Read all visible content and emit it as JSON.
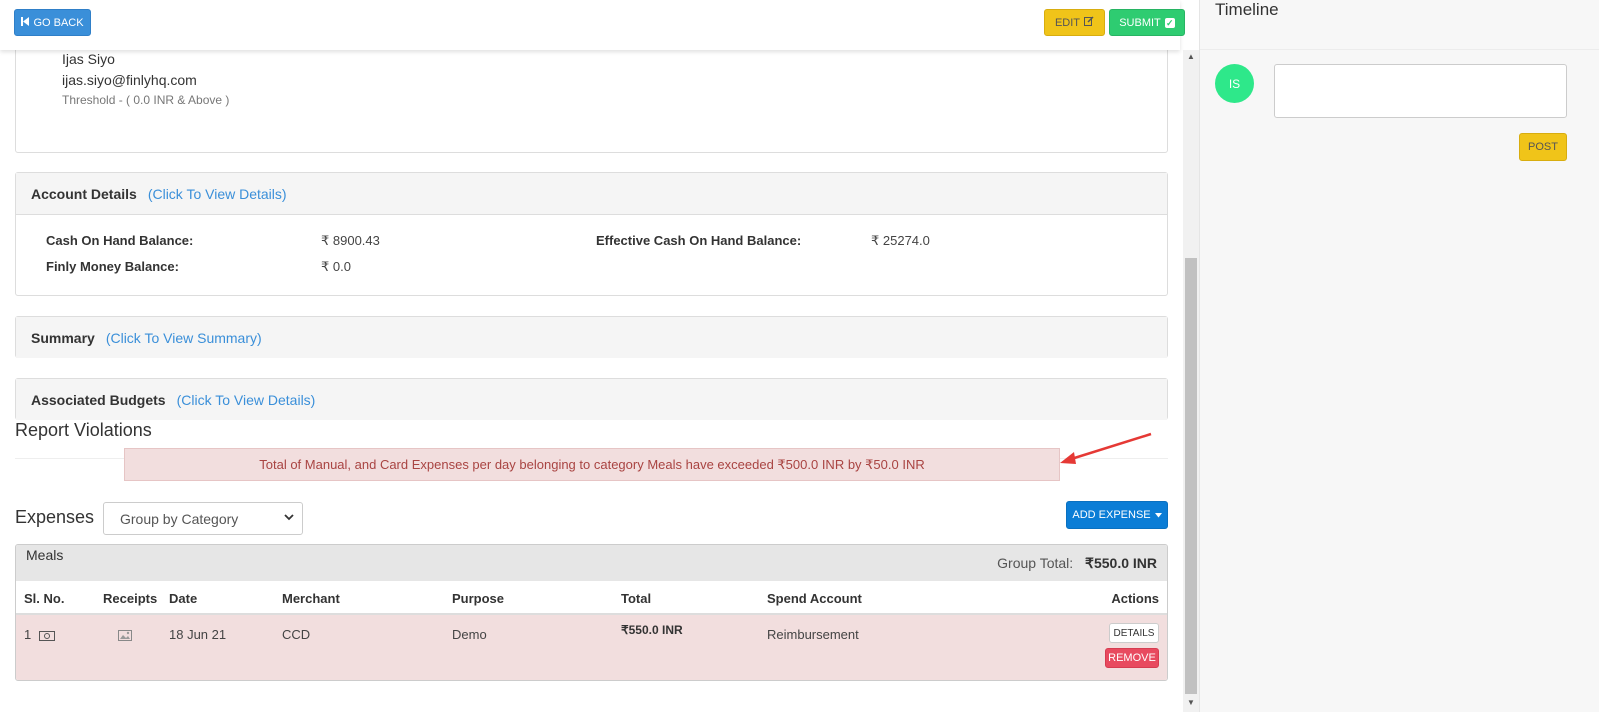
{
  "toolbar": {
    "back_label": "GO BACK",
    "edit_label": "EDIT",
    "submit_label": "SUBMIT"
  },
  "approver": {
    "name": "Ijas Siyo",
    "email": "ijas.siyo@finlyhq.com",
    "threshold": "Threshold -  ( 0.0 INR & Above )"
  },
  "account_details": {
    "title": "Account Details",
    "link": "(Click To View Details)",
    "cash_on_hand_label": "Cash On Hand Balance:",
    "cash_on_hand_value": "₹  8900.43",
    "finly_money_label": "Finly Money Balance:",
    "finly_money_value": "₹  0.0",
    "effective_label": "Effective Cash On Hand Balance:",
    "effective_value": "₹  25274.0"
  },
  "summary": {
    "title": "Summary",
    "link": "(Click To View Summary)"
  },
  "budgets": {
    "title": "Associated Budgets",
    "link": "(Click To View Details)"
  },
  "violations": {
    "title": "Report Violations",
    "message": "Total of Manual, and Card Expenses per day belonging to category Meals have exceeded ₹500.0 INR by ₹50.0 INR"
  },
  "expenses": {
    "title": "Expenses",
    "group_by_selected": "Group by Category",
    "add_label": "ADD EXPENSE",
    "group": {
      "name": "Meals",
      "total_label": "Group Total:",
      "total_value": "₹550.0 INR"
    },
    "columns": [
      "Sl. No.",
      "Receipts",
      "Date",
      "Merchant",
      "Purpose",
      "Total",
      "Spend Account",
      "Actions"
    ],
    "rows": [
      {
        "sl_no": "1",
        "date": "18 Jun 21",
        "merchant": "CCD",
        "purpose": "Demo",
        "total": "₹550.0 INR",
        "spend_account": "Reimbursement",
        "details_label": "DETAILS",
        "remove_label": "REMOVE"
      }
    ]
  },
  "timeline": {
    "title": "Timeline",
    "avatar_initials": "IS",
    "post_label": "POST"
  },
  "colors": {
    "primary": "#3a8fd9",
    "warning": "#f0c419",
    "success": "#2ecc71",
    "danger": "#e84a5f",
    "violation_bg": "#f2dede",
    "avatar": "#2ee88a"
  }
}
